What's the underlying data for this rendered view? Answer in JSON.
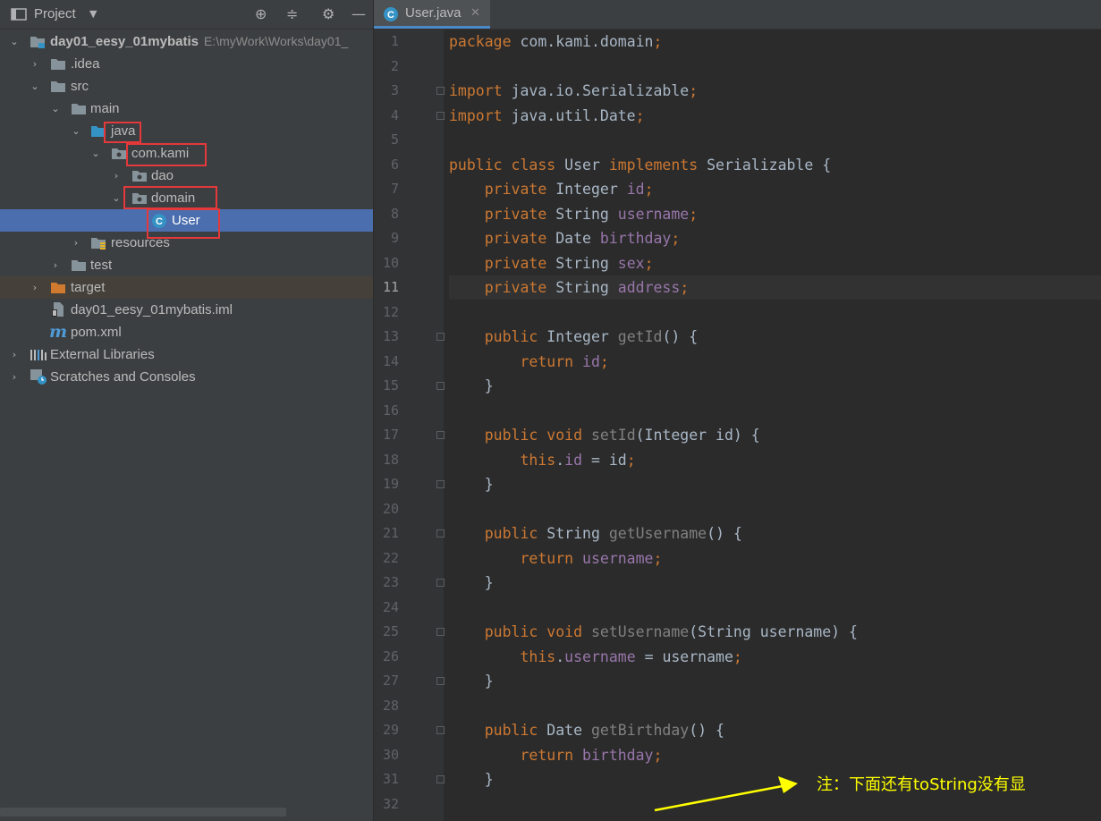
{
  "project_panel": {
    "title": "Project",
    "tree": [
      {
        "label": "day01_eesy_01mybatis",
        "path": "E:\\myWork\\Works\\day01_",
        "bold": true
      },
      {
        "label": ".idea"
      },
      {
        "label": "src"
      },
      {
        "label": "main"
      },
      {
        "label": "java"
      },
      {
        "label": "com.kami"
      },
      {
        "label": "dao"
      },
      {
        "label": "domain"
      },
      {
        "label": "User"
      },
      {
        "label": "resources"
      },
      {
        "label": "test"
      },
      {
        "label": "target"
      },
      {
        "label": "day01_eesy_01mybatis.iml"
      },
      {
        "label": "pom.xml"
      },
      {
        "label": "External Libraries"
      },
      {
        "label": "Scratches and Consoles"
      }
    ]
  },
  "editor": {
    "tab_label": "User.java",
    "current_line": 11,
    "line_numbers": [
      "1",
      "2",
      "3",
      "4",
      "5",
      "6",
      "7",
      "8",
      "9",
      "10",
      "11",
      "12",
      "13",
      "14",
      "15",
      "16",
      "17",
      "18",
      "19",
      "20",
      "21",
      "22",
      "23",
      "24",
      "25",
      "26",
      "27",
      "28",
      "29",
      "30",
      "31",
      "32"
    ],
    "code": [
      [
        {
          "t": "package ",
          "c": "kw"
        },
        {
          "t": "com.kami.domain"
        },
        {
          "t": ";",
          "c": "kw"
        }
      ],
      [],
      [
        {
          "t": "import ",
          "c": "kw"
        },
        {
          "t": "java.io.Serializable"
        },
        {
          "t": ";",
          "c": "kw"
        }
      ],
      [
        {
          "t": "import ",
          "c": "kw"
        },
        {
          "t": "java.util.Date"
        },
        {
          "t": ";",
          "c": "kw"
        }
      ],
      [],
      [
        {
          "t": "public class ",
          "c": "kw"
        },
        {
          "t": "User "
        },
        {
          "t": "implements ",
          "c": "kw"
        },
        {
          "t": "Serializable {"
        }
      ],
      [
        {
          "t": "    private ",
          "c": "kw"
        },
        {
          "t": "Integer "
        },
        {
          "t": "id",
          "c": "fld"
        },
        {
          "t": ";",
          "c": "kw"
        }
      ],
      [
        {
          "t": "    private ",
          "c": "kw"
        },
        {
          "t": "String "
        },
        {
          "t": "username",
          "c": "fld"
        },
        {
          "t": ";",
          "c": "kw"
        }
      ],
      [
        {
          "t": "    private ",
          "c": "kw"
        },
        {
          "t": "Date "
        },
        {
          "t": "birthday",
          "c": "fld"
        },
        {
          "t": ";",
          "c": "kw"
        }
      ],
      [
        {
          "t": "    private ",
          "c": "kw"
        },
        {
          "t": "String "
        },
        {
          "t": "sex",
          "c": "fld"
        },
        {
          "t": ";",
          "c": "kw"
        }
      ],
      [
        {
          "t": "    private ",
          "c": "kw"
        },
        {
          "t": "String "
        },
        {
          "t": "address",
          "c": "fld"
        },
        {
          "t": ";",
          "c": "kw"
        }
      ],
      [],
      [
        {
          "t": "    public ",
          "c": "kw"
        },
        {
          "t": "Integer "
        },
        {
          "t": "getId",
          "c": "mth"
        },
        {
          "t": "() {"
        }
      ],
      [
        {
          "t": "        return ",
          "c": "kw"
        },
        {
          "t": "id",
          "c": "fld"
        },
        {
          "t": ";",
          "c": "kw"
        }
      ],
      [
        {
          "t": "    }"
        }
      ],
      [],
      [
        {
          "t": "    public void ",
          "c": "kw"
        },
        {
          "t": "setId",
          "c": "mth"
        },
        {
          "t": "(Integer id) {"
        }
      ],
      [
        {
          "t": "        this",
          "c": "kw"
        },
        {
          "t": "."
        },
        {
          "t": "id",
          "c": "fld"
        },
        {
          "t": " = id"
        },
        {
          "t": ";",
          "c": "kw"
        }
      ],
      [
        {
          "t": "    }"
        }
      ],
      [],
      [
        {
          "t": "    public ",
          "c": "kw"
        },
        {
          "t": "String "
        },
        {
          "t": "getUsername",
          "c": "mth"
        },
        {
          "t": "() {"
        }
      ],
      [
        {
          "t": "        return ",
          "c": "kw"
        },
        {
          "t": "username",
          "c": "fld"
        },
        {
          "t": ";",
          "c": "kw"
        }
      ],
      [
        {
          "t": "    }"
        }
      ],
      [],
      [
        {
          "t": "    public void ",
          "c": "kw"
        },
        {
          "t": "setUsername",
          "c": "mth"
        },
        {
          "t": "(String username) {"
        }
      ],
      [
        {
          "t": "        this",
          "c": "kw"
        },
        {
          "t": "."
        },
        {
          "t": "username",
          "c": "fld"
        },
        {
          "t": " = username"
        },
        {
          "t": ";",
          "c": "kw"
        }
      ],
      [
        {
          "t": "    }"
        }
      ],
      [],
      [
        {
          "t": "    public ",
          "c": "kw"
        },
        {
          "t": "Date "
        },
        {
          "t": "getBirthday",
          "c": "mth"
        },
        {
          "t": "() {"
        }
      ],
      [
        {
          "t": "        return ",
          "c": "kw"
        },
        {
          "t": "birthday",
          "c": "fld"
        },
        {
          "t": ";",
          "c": "kw"
        }
      ],
      [
        {
          "t": "    }"
        }
      ],
      []
    ]
  },
  "annotation": {
    "text": "注：下面还有toString没有显",
    "color": "#ffff00"
  },
  "colors": {
    "keyword": "#cc7832",
    "field": "#9876aa",
    "method": "#808080",
    "plain": "#a9b7c6",
    "selection": "#4b6eaf",
    "highlight_box": "#e5383b"
  }
}
